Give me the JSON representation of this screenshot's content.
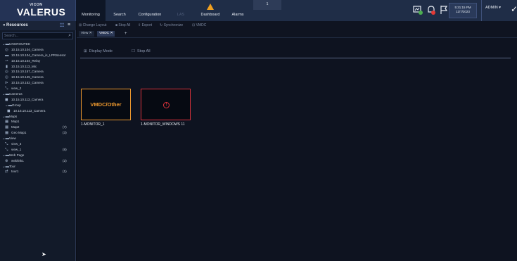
{
  "brand": {
    "top": "VICON",
    "main": "VALERUS"
  },
  "nav": [
    {
      "label": "Monitoring"
    },
    {
      "label": "Search"
    },
    {
      "label": "Configuration"
    },
    {
      "label": "LAS"
    },
    {
      "label": "Dashboard"
    },
    {
      "label": "Alarms"
    }
  ],
  "notice": {
    "count": "1"
  },
  "clock": {
    "time": "5:31:15 PM",
    "date": "11/7/2023"
  },
  "user": {
    "name": "ADMIN ▾"
  },
  "sidebar": {
    "title": "Resources",
    "search_placeholder": "Search...",
    "items": [
      {
        "label": "UNGROUPED",
        "count": ""
      },
      {
        "label": "10.15.10.104_Camera",
        "count": ""
      },
      {
        "label": "10.15.10.104_Camera_is_LPRSensor",
        "count": ""
      },
      {
        "label": "10.15.10.104_Relay",
        "count": ""
      },
      {
        "label": "10.15.10.113_Mic",
        "count": ""
      },
      {
        "label": "10.15.10.157_Camera",
        "count": ""
      },
      {
        "label": "10.15.10.145_Camera",
        "count": ""
      },
      {
        "label": "10.15.10.152_Camera",
        "count": ""
      },
      {
        "label": "view_2",
        "count": ""
      },
      {
        "label": "Cameras",
        "count": ""
      },
      {
        "label": "10.15.10.113_Camera",
        "count": ""
      },
      {
        "label": "Group",
        "count": ""
      },
      {
        "label": "10.15.10.113_Camera",
        "count": ""
      },
      {
        "label": "Maps",
        "count": ""
      },
      {
        "label": "Map1",
        "count": ""
      },
      {
        "label": "Map2",
        "count": "(7)"
      },
      {
        "label": "Geo Map1",
        "count": "(3)"
      },
      {
        "label": "View",
        "count": ""
      },
      {
        "label": "view_3",
        "count": ""
      },
      {
        "label": "view_1",
        "count": "(8)"
      },
      {
        "label": "Web Page",
        "count": ""
      },
      {
        "label": "weblink1",
        "count": "(2)"
      },
      {
        "label": "Tour",
        "count": ""
      },
      {
        "label": "tour1",
        "count": "(1)"
      }
    ]
  },
  "toolbar": {
    "change_layout": "Change Layout",
    "stop_all": "Stop All",
    "export": "Export",
    "synchronize": "Synchronize",
    "vmdc": "VMDC"
  },
  "tabs": [
    {
      "label": "View ✕"
    },
    {
      "label": "VMDC ✕"
    },
    {
      "label": "+"
    }
  ],
  "content": {
    "display_mode": "Display Mode",
    "stop_all": "Stop All",
    "tiles": [
      {
        "title": "VMDC/Other",
        "label": "1-MONITOR_1"
      },
      {
        "title": "!",
        "label": "1-MONITOR_WINDOWS 11"
      }
    ]
  },
  "colors": {
    "accent_orange": "#f09a2e",
    "error_red": "#d8303a",
    "topbar": "#1f2d47"
  }
}
